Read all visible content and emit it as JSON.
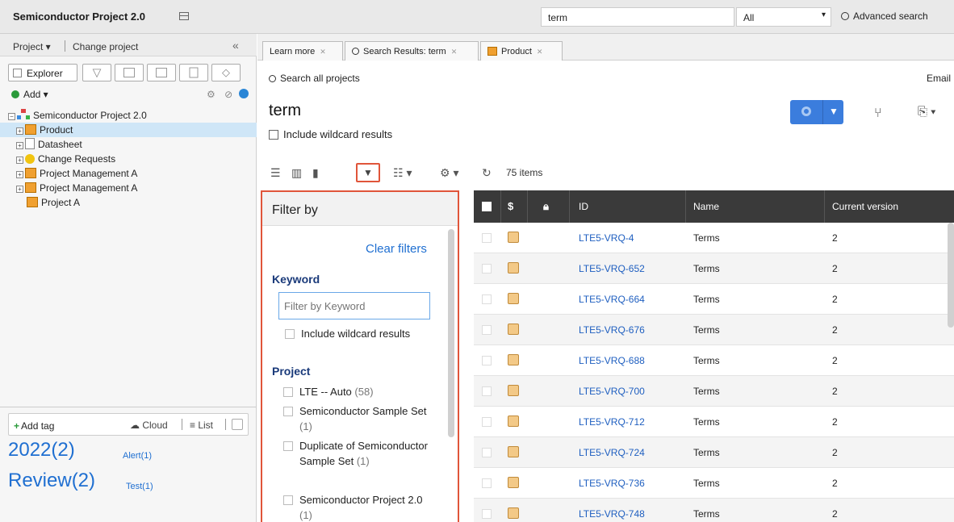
{
  "app": {
    "title": "Semiconductor Project 2.0"
  },
  "search": {
    "value": "term",
    "scope": "All",
    "advanced_label": "Advanced search"
  },
  "sidebar": {
    "project_menu": "Project ▾",
    "change_project": "Change project",
    "collapse": "«",
    "explorer_tab": "Explorer",
    "add_label": "Add ▾",
    "tree": [
      {
        "label": "Semiconductor Project 2.0",
        "icon": "org-icon",
        "expander": "⊟"
      },
      {
        "label": "Product",
        "icon": "grid-icon",
        "expander": "⊞",
        "selected": true
      },
      {
        "label": "Datasheet",
        "icon": "doc-icon",
        "expander": "⊞"
      },
      {
        "label": "Change Requests",
        "icon": "bulb-icon",
        "expander": "⊞"
      },
      {
        "label": "Project Management A",
        "icon": "grid-icon",
        "expander": "⊞"
      },
      {
        "label": "Project Management A",
        "icon": "grid-icon",
        "expander": "⊞"
      },
      {
        "label": "Project A",
        "icon": "grid-icon",
        "expander": ""
      }
    ],
    "tags": {
      "add_tag": "Add tag",
      "cloud": "Cloud",
      "list": "List",
      "items": [
        {
          "label": "2022(2)",
          "size": "big"
        },
        {
          "label": "Alert(1)",
          "size": "small"
        },
        {
          "label": "Review(2)",
          "size": "big"
        },
        {
          "label": "Test(1)",
          "size": "small"
        }
      ]
    }
  },
  "tabs": [
    {
      "label": "Learn more"
    },
    {
      "label": "Search Results: term"
    },
    {
      "label": "Product"
    }
  ],
  "main": {
    "search_all": "Search all projects",
    "email": "Email",
    "title": "term",
    "wildcard": "Include wildcard results",
    "items_count": "75 items"
  },
  "filter": {
    "title": "Filter by",
    "clear": "Clear filters",
    "keyword_heading": "Keyword",
    "keyword_placeholder": "Filter by Keyword",
    "keyword_wildcard": "Include wildcard results",
    "project_heading": "Project",
    "projects": [
      {
        "name": "LTE -- Auto",
        "count": "(58)"
      },
      {
        "name": "Semiconductor Sample Set",
        "count": "(1)"
      },
      {
        "name": "Duplicate of Semiconductor Sample Set",
        "count": "(1)"
      },
      {
        "name": "Semiconductor Project 2.0",
        "count": "(1)"
      }
    ]
  },
  "table": {
    "columns": [
      "ID",
      "Name",
      "Current version"
    ],
    "rows": [
      {
        "id": "LTE5-VRQ-4",
        "name": "Terms",
        "version": "2"
      },
      {
        "id": "LTE5-VRQ-652",
        "name": "Terms",
        "version": "2"
      },
      {
        "id": "LTE5-VRQ-664",
        "name": "Terms",
        "version": "2"
      },
      {
        "id": "LTE5-VRQ-676",
        "name": "Terms",
        "version": "2"
      },
      {
        "id": "LTE5-VRQ-688",
        "name": "Terms",
        "version": "2"
      },
      {
        "id": "LTE5-VRQ-700",
        "name": "Terms",
        "version": "2"
      },
      {
        "id": "LTE5-VRQ-712",
        "name": "Terms",
        "version": "2"
      },
      {
        "id": "LTE5-VRQ-724",
        "name": "Terms",
        "version": "2"
      },
      {
        "id": "LTE5-VRQ-736",
        "name": "Terms",
        "version": "2"
      },
      {
        "id": "LTE5-VRQ-748",
        "name": "Terms",
        "version": "2"
      }
    ]
  }
}
